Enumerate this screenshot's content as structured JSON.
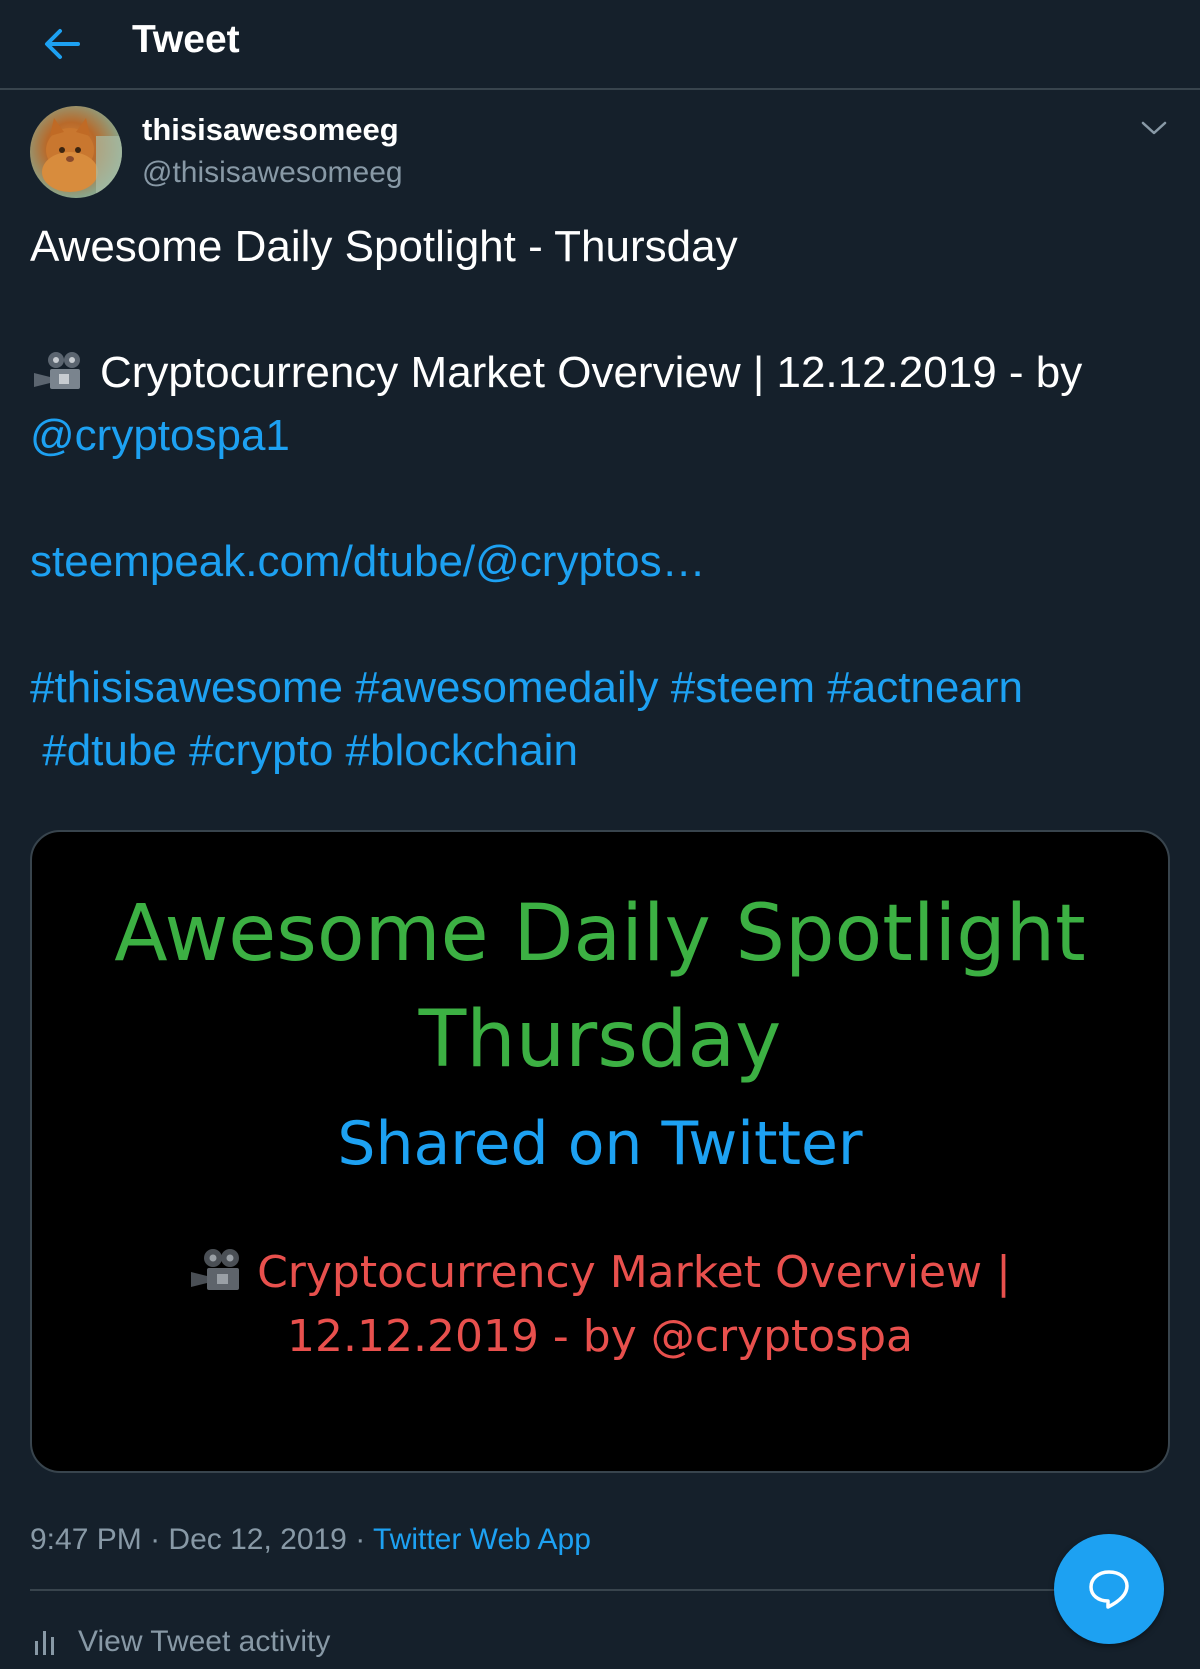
{
  "header": {
    "title": "Tweet",
    "back_icon": "arrow-left-icon"
  },
  "tweet": {
    "display_name": "thisisawesomeeg",
    "handle": "@thisisawesomeeg",
    "more_icon": "chevron-down-icon",
    "text": {
      "line1": "Awesome Daily Spotlight - Thursday",
      "line2_emoji": "movie-camera-icon",
      "line2": "Cryptocurrency Market Overview | 12.12.2019 - by",
      "mention": "@cryptospa1",
      "link": "steempeak.com/dtube/@cryptos…",
      "hashtags_line1": "#thisisawesome #awesomedaily #steem #actnearn",
      "hashtags_line2": " #dtube #crypto #blockchain"
    },
    "media": {
      "title": "Awesome Daily Spotlight",
      "subtitle": "Thursday",
      "shared": "Shared on Twitter",
      "line1": "Cryptocurrency Market Overview |",
      "line2": "12.12.2019 - by @cryptospa",
      "title_color": "#3cb043",
      "shared_color": "#1da1f2",
      "body_color": "#e8504d"
    },
    "meta": {
      "time": "9:47 PM",
      "separator": " · ",
      "date": "Dec 12, 2019",
      "source": "Twitter Web App"
    },
    "activity_label": "View Tweet activity",
    "activity_icon": "bar-chart-icon"
  },
  "fab": {
    "icon": "speech-bubble-icon"
  },
  "colors": {
    "background": "#15202b",
    "accent": "#1da1f2",
    "muted": "#8899a6",
    "border": "#38444d"
  }
}
